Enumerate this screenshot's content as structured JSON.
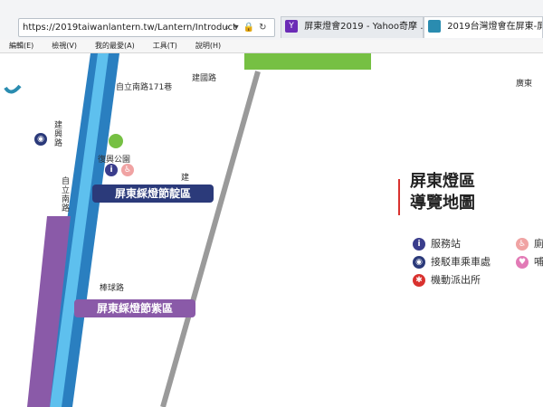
{
  "browser": {
    "url": "https://2019taiwanlantern.tw/Lantern/Introduct",
    "tabs": [
      {
        "label": "屏東燈會2019 - Yahoo奇摩 …",
        "favicon": "Y"
      },
      {
        "label": "2019台灣燈會在屏東-屏…",
        "favicon": ""
      }
    ]
  },
  "menu": {
    "items": [
      "編輯(E)",
      "檢視(V)",
      "我的最愛(A)",
      "工具(T)",
      "說明(H)"
    ]
  },
  "map": {
    "streets": {
      "ziliNan171": "自立南路171巷",
      "jianguo": "建國路",
      "guangdong": "廣東",
      "jianxing": "建興路",
      "zili": "自立南路",
      "jian": "建",
      "bangqiu": "棒球路"
    },
    "park_label": "復興公園",
    "zones": {
      "indigo": "屏東綵燈節靛區",
      "purple": "屏東綵燈節紫區"
    }
  },
  "legend": {
    "title_line1": "屏東燈區",
    "title_line2": "導覽地圖",
    "items": [
      {
        "label": "服務站",
        "icon": "info-icon"
      },
      {
        "label": "接駁車乘車處",
        "icon": "shuttle-icon"
      },
      {
        "label": "機動派出所",
        "icon": "police-icon"
      }
    ],
    "partial_items": [
      "廁",
      "哺"
    ]
  },
  "colors": {
    "accent_red": "#d9322f",
    "indigo_zone": "#2b3a7a",
    "purple_zone": "#8a5aa8",
    "road_blue": "#4fb4e6",
    "green_park": "#76c043"
  }
}
